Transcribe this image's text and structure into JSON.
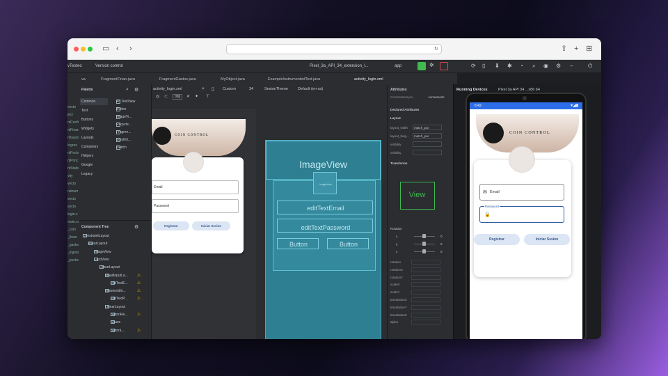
{
  "ide": {
    "project": "vTesteo",
    "vcs": "Version control",
    "device": "Pixel_3a_API_34_extension_l...",
    "module": "app"
  },
  "tabs": [
    "va",
    "FragmentFinan.java",
    "FragmentGastos.java",
    "MyObject.java",
    "ExampleInstrumentedTest.java",
    "activity_login.xml"
  ],
  "left_gutter": [
    "vecto",
    "ject",
    "ntConfi",
    "ntFinan",
    "ntGasto",
    "Ingres",
    "ntPocke",
    "ntPrinc",
    "ntStatis",
    "vity",
    "vecto",
    "nstrum",
    "vecto",
    "vecto",
    "login.x",
    "main.xm",
    "_coin",
    "_finan",
    "_gastos",
    "_ingres",
    "_pocke"
  ],
  "palette": {
    "title": "Palette",
    "categories": [
      "Common",
      "Text",
      "Buttons",
      "Widgets",
      "Layouts",
      "Containers",
      "Helpers",
      "Google",
      "Legacy"
    ],
    "items": [
      "Ab TextView",
      "Button",
      "ImageVi...",
      "Recycle...",
      "Fragme...",
      "ScrollVi...",
      "Switch"
    ]
  },
  "tree": {
    "title": "Component Tree",
    "items": [
      {
        "label": "ConstraintLayout",
        "depth": 0,
        "warn": false
      },
      {
        "label": "linearLayout",
        "depth": 1,
        "warn": false
      },
      {
        "label": "ImageView",
        "depth": 2,
        "warn": false
      },
      {
        "label": "CardView",
        "depth": 2,
        "warn": false
      },
      {
        "label": "LinearLayout",
        "depth": 3,
        "warn": false
      },
      {
        "label": "emailInputLa...",
        "depth": 4,
        "warn": true
      },
      {
        "label": "editTextE...",
        "depth": 5,
        "warn": true
      },
      {
        "label": "passwordIn...",
        "depth": 4,
        "warn": true
      },
      {
        "label": "editTextP...",
        "depth": 5,
        "warn": true
      },
      {
        "label": "LinearLayout",
        "depth": 4,
        "warn": false
      },
      {
        "label": "buttonRe...",
        "depth": 5,
        "warn": true
      },
      {
        "label": "Space",
        "depth": 5,
        "warn": false
      },
      {
        "label": "buttonL...",
        "depth": 5,
        "warn": true
      }
    ]
  },
  "design_toolbar": {
    "file": "activity_login.xml",
    "custom": "Custom",
    "api": "34",
    "theme": "SesionTheme",
    "locale": "Default (en-us)",
    "dp": "0dp"
  },
  "design": {
    "brand": "COIN CONTROL",
    "email": "Email",
    "password": "Password",
    "register": "Registrar",
    "login": "Iniciar Sesion"
  },
  "blueprint": {
    "image": "ImageView",
    "image_small": "ImageView",
    "email": "editTextEmail",
    "password": "editTextPassword",
    "btn1": "Button",
    "btn2": "Button"
  },
  "attrs": {
    "title": "Attributes",
    "component": "ConstraintLayou",
    "unnamed": "<unnamed>",
    "declared": "Declared Attributes",
    "layout": "Layout",
    "rows": [
      {
        "k": "layout_width",
        "v": "match_par"
      },
      {
        "k": "layout_heig...",
        "v": "match_par"
      },
      {
        "k": "visibility",
        "v": ""
      },
      {
        "k": "visibility",
        "v": ""
      }
    ],
    "transforms": "Transforms",
    "view": "View",
    "rotation": "Rotation",
    "axes": [
      "x",
      "y",
      "z"
    ],
    "zero": "0",
    "props": [
      "rotation",
      "rotationX",
      "rotationY",
      "scaleX",
      "scaleY",
      "translationX",
      "translationY",
      "translationZ",
      "alpha"
    ]
  },
  "running": {
    "title": "Running Devices",
    "device": "Pixel 3a API 34 ...x86 64",
    "time": "6:42"
  },
  "app": {
    "brand": "COIN CONTROL",
    "email": "Email",
    "password": "Password",
    "register": "Registrar",
    "login": "Iniciar Sesion"
  },
  "colors": {
    "accent": "#3574f0",
    "warn": "#e5b800",
    "blueprint": "#2e7f91",
    "green": "#3fb950"
  }
}
